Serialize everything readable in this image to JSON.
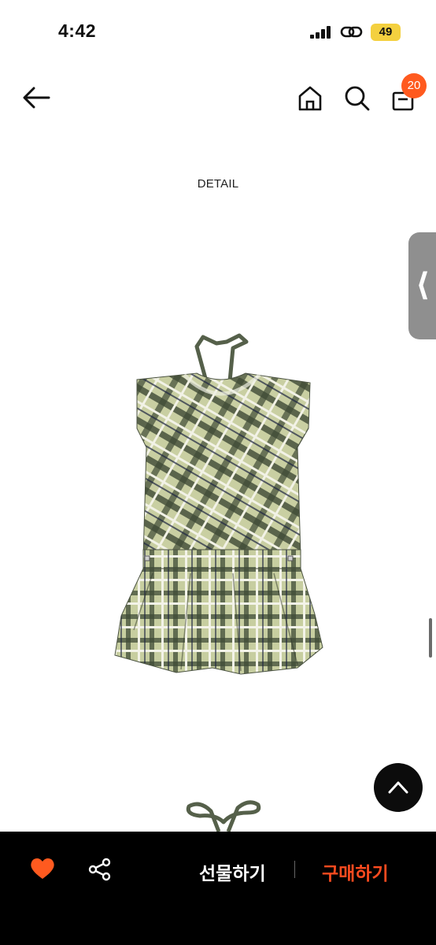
{
  "status_bar": {
    "time": "4:42",
    "battery": "49"
  },
  "nav": {
    "cart_count": "20"
  },
  "content": {
    "detail_label": "DETAIL"
  },
  "bottom": {
    "gift_label": "선물하기",
    "buy_label": "구매하기"
  },
  "colors": {
    "accent": "#ff5a1f",
    "buy": "#ff4b1f"
  }
}
